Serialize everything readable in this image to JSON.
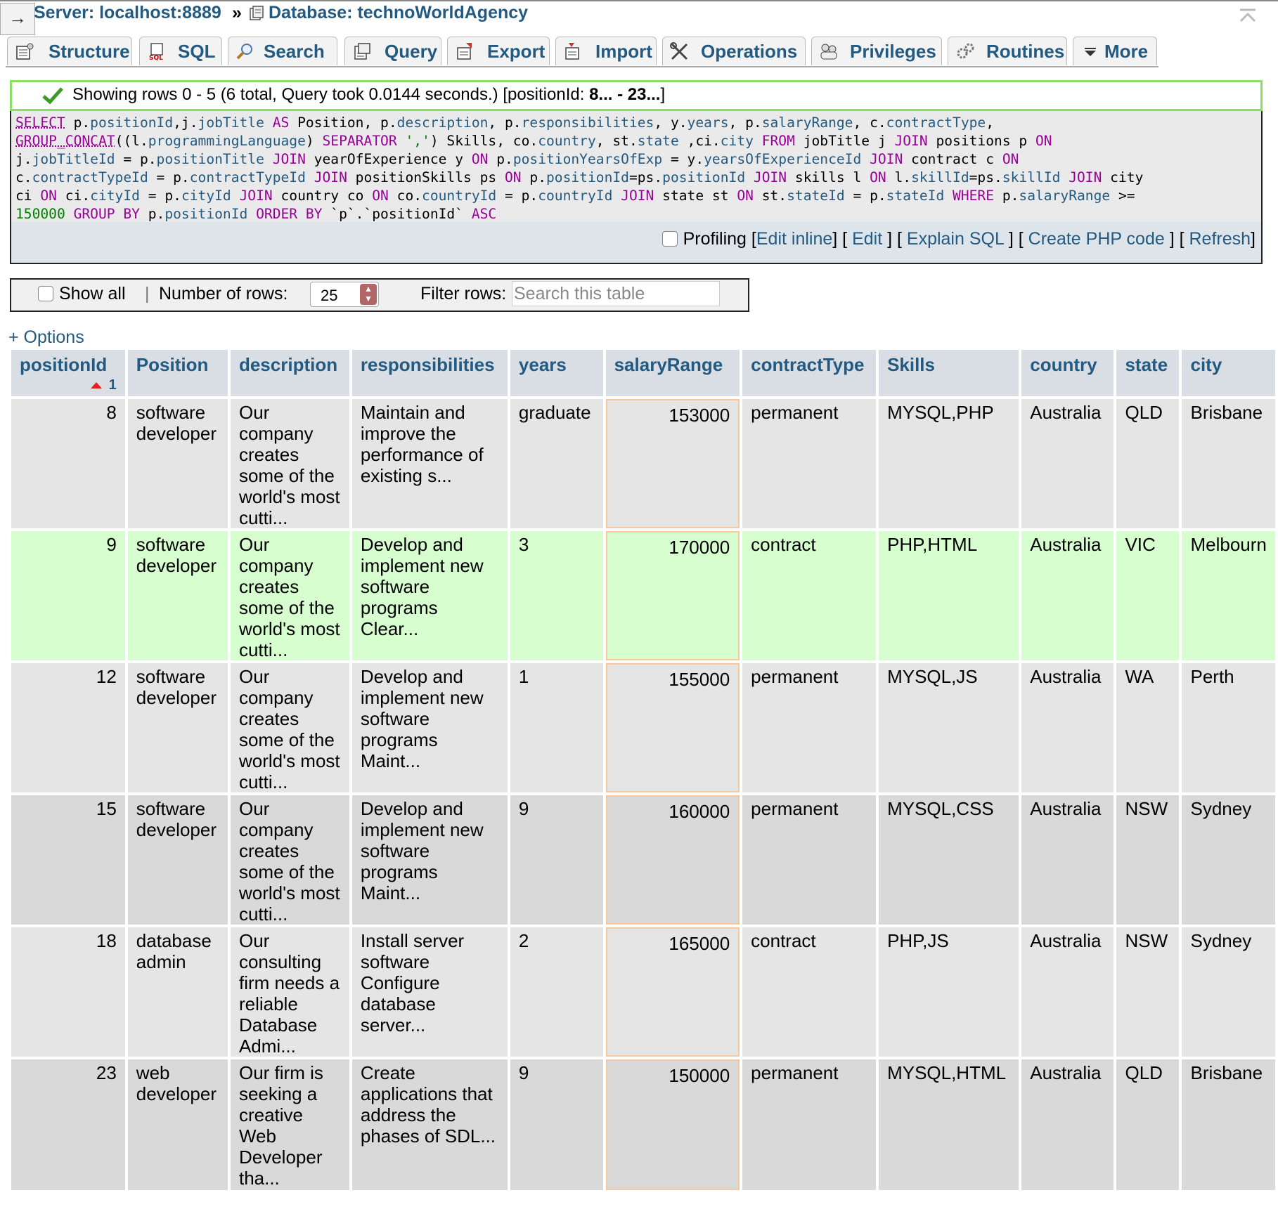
{
  "breadcrumb": {
    "server": "Server: localhost:8889",
    "separator": "»",
    "database": "Database: technoWorldAgency"
  },
  "tabs": [
    {
      "label": "Structure",
      "icon": "structure-icon"
    },
    {
      "label": "SQL",
      "icon": "sql-icon"
    },
    {
      "label": "Search",
      "icon": "search-icon"
    },
    {
      "label": "Query",
      "icon": "query-icon"
    },
    {
      "label": "Export",
      "icon": "export-icon"
    },
    {
      "label": "Import",
      "icon": "import-icon"
    },
    {
      "label": "Operations",
      "icon": "operations-icon"
    },
    {
      "label": "Privileges",
      "icon": "privileges-icon"
    },
    {
      "label": "Routines",
      "icon": "routines-icon"
    },
    {
      "label": "More",
      "icon": "chevron-down-icon"
    }
  ],
  "success": {
    "text": "Showing rows 0 - 5 (6 total, Query took 0.0144 seconds.) [positionId: ",
    "range": "8... - 23...",
    "end": "]"
  },
  "sql": {
    "query": "SELECT p.positionId,j.jobTitle AS Position, p.description, p.responsibilities, y.years, p.salaryRange, c.contractType, GROUP_CONCAT((l.programmingLanguage) SEPARATOR ',') Skills, co.country, st.state ,ci.city FROM jobTitle j JOIN positions p ON j.jobTitleId = p.positionTitle JOIN yearOfExperience y ON p.positionYearsOfExp = y.yearsOfExperienceId JOIN contract c ON c.contractTypeId = p.contractTypeId JOIN positionSkills ps ON p.positionId=ps.positionId JOIN skills l ON l.skillId=ps.skillId JOIN city ci ON ci.cityId = p.cityId JOIN country co ON co.countryId = p.countryId JOIN state st ON st.stateId = p.stateId WHERE p.salaryRange >= 150000 GROUP BY p.positionId ORDER BY `p`.`positionId` ASC",
    "profiling": "Profiling",
    "edit_inline": "Edit inline",
    "edit": "Edit",
    "explain": "Explain SQL",
    "create_php": "Create PHP code",
    "refresh": "Refresh"
  },
  "navbar": {
    "show_all": "Show all",
    "divider": "|",
    "rows_label": "Number of rows:",
    "rows_value": "25",
    "filter_label": "Filter rows:",
    "filter_placeholder": "Search this table"
  },
  "options_link": "+ Options",
  "table": {
    "columns": [
      "positionId",
      "Position",
      "description",
      "responsibilities",
      "years",
      "salaryRange",
      "contractType",
      "Skills",
      "country",
      "state",
      "city"
    ],
    "sort_index": "1",
    "rows": [
      {
        "positionId": "8",
        "position": "software developer",
        "description": "Our company creates some of the world's most cutti...",
        "responsibilities": "Maintain and improve the performance of existing s...",
        "years": "graduate",
        "salary": "153000",
        "contract": "permanent",
        "skills": "MYSQL,PHP",
        "country": "Australia",
        "state": "QLD",
        "city": "Brisbane"
      },
      {
        "positionId": "9",
        "position": "software developer",
        "description": "Our company creates some of the world's most cutti...",
        "responsibilities": "Develop and implement new software programs Clear...",
        "years": "3",
        "salary": "170000",
        "contract": "contract",
        "skills": "PHP,HTML",
        "country": "Australia",
        "state": "VIC",
        "city": "Melbourn"
      },
      {
        "positionId": "12",
        "position": "software developer",
        "description": "Our company creates some of the world's most cutti...",
        "responsibilities": "Develop and implement new software programs Maint...",
        "years": "1",
        "salary": "155000",
        "contract": "permanent",
        "skills": "MYSQL,JS",
        "country": "Australia",
        "state": "WA",
        "city": "Perth"
      },
      {
        "positionId": "15",
        "position": "software developer",
        "description": "Our company creates some of the world's most cutti...",
        "responsibilities": "Develop and implement new software programs Maint...",
        "years": "9",
        "salary": "160000",
        "contract": "permanent",
        "skills": "MYSQL,CSS",
        "country": "Australia",
        "state": "NSW",
        "city": "Sydney"
      },
      {
        "positionId": "18",
        "position": "database admin",
        "description": "Our consulting firm needs a reliable Database Admi...",
        "responsibilities": "Install server software Configure database server...",
        "years": "2",
        "salary": "165000",
        "contract": "contract",
        "skills": "PHP,JS",
        "country": "Australia",
        "state": "NSW",
        "city": "Sydney"
      },
      {
        "positionId": "23",
        "position": "web developer",
        "description": "Our firm is seeking a creative Web Developer tha...",
        "responsibilities": "Create applications that address the phases of SDL...",
        "years": "9",
        "salary": "150000",
        "contract": "permanent",
        "skills": "MYSQL,HTML",
        "country": "Australia",
        "state": "QLD",
        "city": "Brisbane"
      }
    ]
  },
  "colors": {
    "link": "#235a81",
    "success_border": "#88e060",
    "marked_row": "#d6fecf",
    "header_bg": "#d8dee4"
  }
}
